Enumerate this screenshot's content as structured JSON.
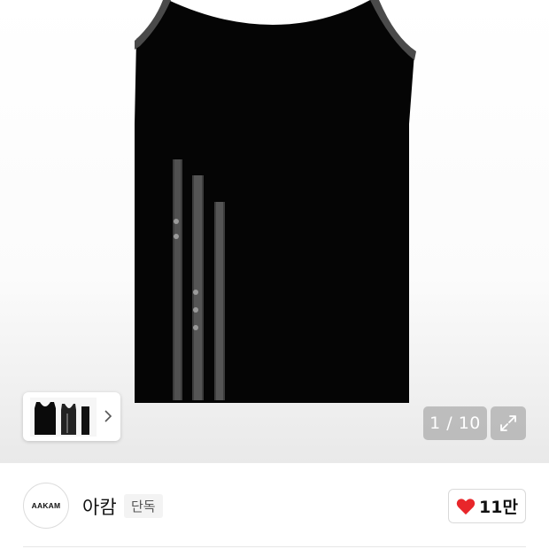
{
  "gallery": {
    "image_alt": "sleeveless tank top",
    "counter_text": "1 / 10",
    "thumbnails": [
      "tank-top-black",
      "tank-top-grey",
      "tank-top-side"
    ],
    "thumbnail_next_icon": "chevron-right-icon",
    "expand_icon": "expand-icon"
  },
  "store": {
    "logo_text": "AAKAM",
    "name": "아캄",
    "badge": "단독",
    "like_icon": "heart-icon",
    "like_color": "#e8262a",
    "like_count": "11만"
  }
}
